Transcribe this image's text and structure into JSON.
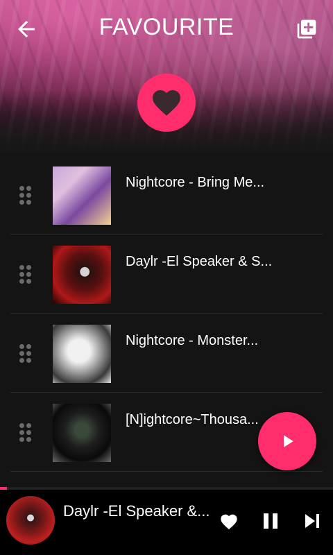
{
  "header": {
    "title": "FAVOURITE",
    "back_icon": "arrow-back-icon",
    "add_icon": "playlist-add-icon",
    "badge_icon": "heart-icon"
  },
  "songs": [
    {
      "title": "Nightcore - Bring Me...",
      "art": "anime-girl-blonde-artwork"
    },
    {
      "title": "Daylr -El Speaker & S...",
      "art": "dark-red-figure-artwork"
    },
    {
      "title": "Nightcore - Monster...",
      "art": "monochrome-girl-artwork"
    },
    {
      "title": "[N]ightcore~Thousa...",
      "art": "dark-hooded-figure-artwork"
    }
  ],
  "fab": {
    "icon": "play-icon"
  },
  "now_playing": {
    "title": "Daylr -El Speaker &...",
    "progress": 0.02
  },
  "colors": {
    "accent": "#ff2d6c",
    "background": "#141414",
    "player_background": "#000000"
  }
}
